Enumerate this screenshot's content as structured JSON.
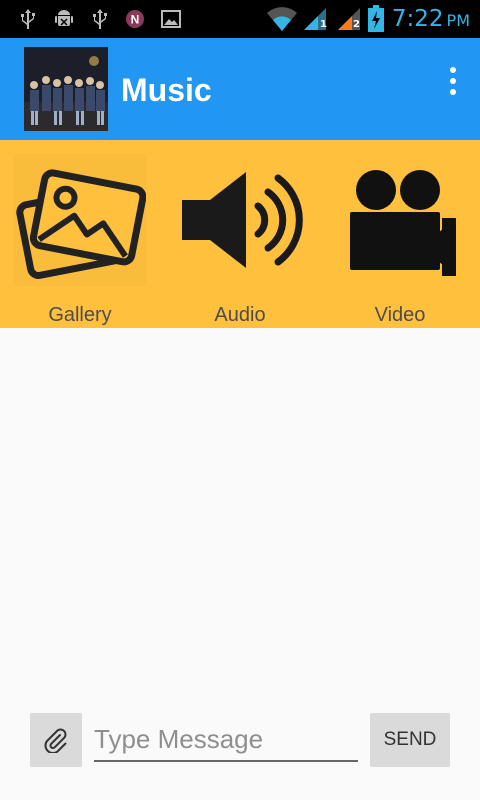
{
  "status_bar": {
    "time": "7:22",
    "ampm": "PM",
    "sim1_label": "1",
    "sim2_label": "2",
    "icons": [
      "usb-icon",
      "android-debug-icon",
      "usb-icon",
      "n-notification-icon",
      "image-icon",
      "wifi-icon",
      "signal-sim1-icon",
      "signal-sim2-icon",
      "battery-charging-icon"
    ]
  },
  "app_bar": {
    "title": "Music",
    "menu_icon": "more-vert-icon",
    "color": "#2196f3"
  },
  "attach_options": [
    {
      "label": "Gallery",
      "icon": "gallery-icon"
    },
    {
      "label": "Audio",
      "icon": "speaker-icon"
    },
    {
      "label": "Video",
      "icon": "video-camera-icon"
    }
  ],
  "attach_bar": {
    "color": "#ffc13d"
  },
  "compose": {
    "placeholder": "Type Message",
    "value": "",
    "send_label": "SEND",
    "attach_icon": "paperclip-icon"
  }
}
